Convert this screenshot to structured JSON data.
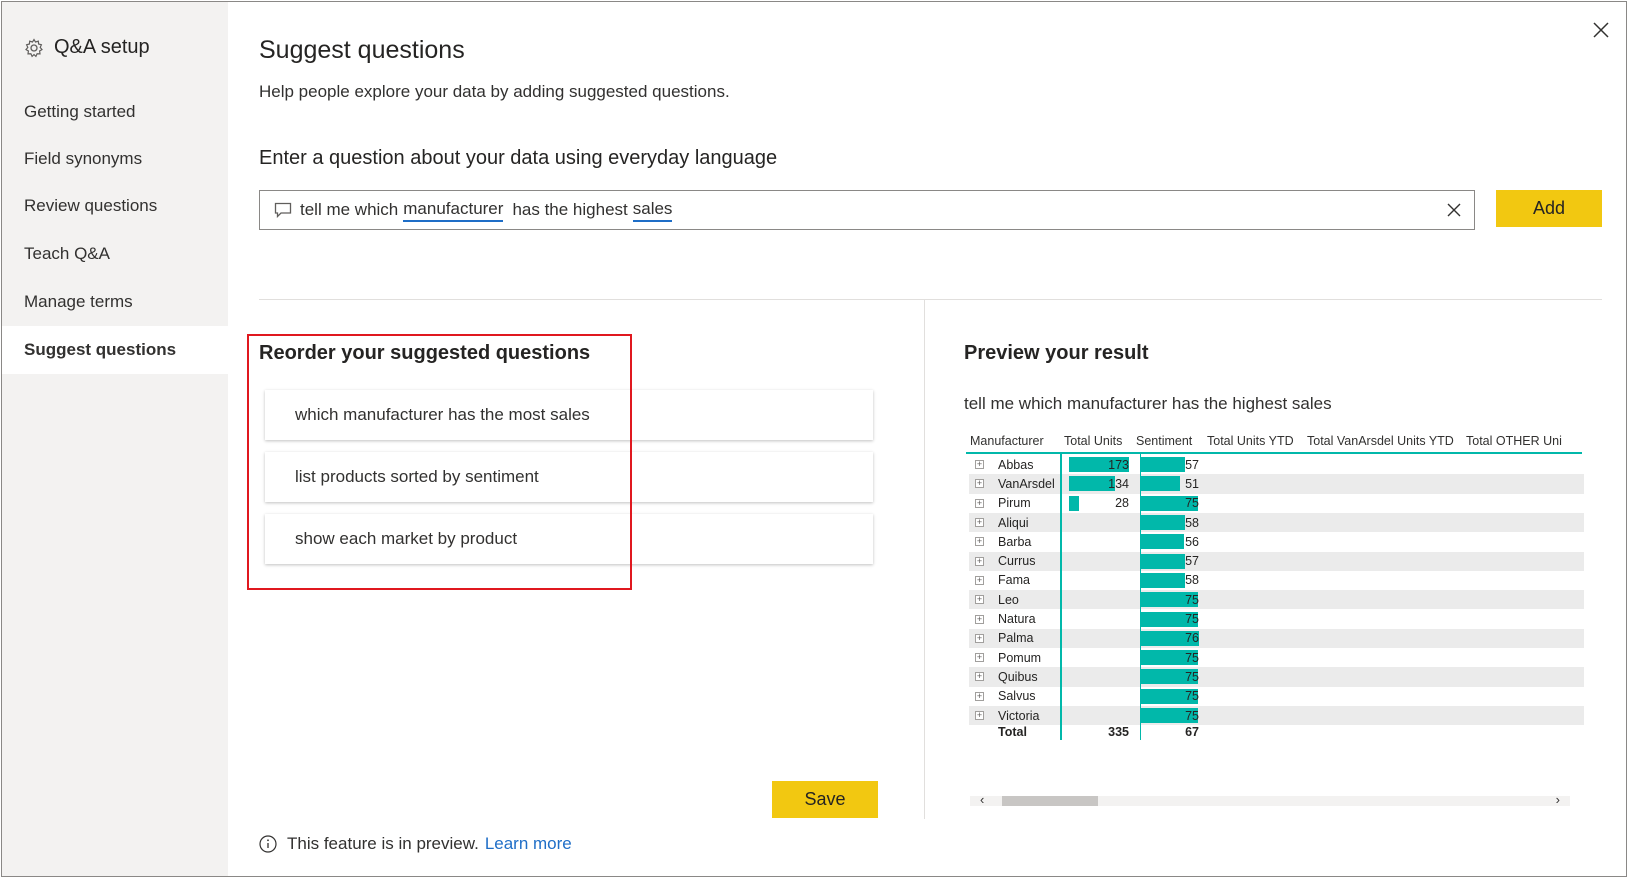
{
  "sidebar": {
    "title": "Q&A setup",
    "items": [
      {
        "label": "Getting started"
      },
      {
        "label": "Field synonyms"
      },
      {
        "label": "Review questions"
      },
      {
        "label": "Teach Q&A"
      },
      {
        "label": "Manage terms"
      },
      {
        "label": "Suggest questions"
      }
    ]
  },
  "main": {
    "title": "Suggest questions",
    "subtitle": "Help people explore your data by adding suggested questions.",
    "prompt_label": "Enter a question about your data using everyday language",
    "question": {
      "part1": "tell me which",
      "part2": "manufacturer",
      "part3": "has the highest",
      "part4": "sales"
    },
    "add_label": "Add",
    "reorder_title": "Reorder your suggested questions",
    "suggestions": [
      "which manufacturer has the most sales",
      "list products sorted by sentiment",
      "show each market by product"
    ],
    "save_label": "Save",
    "preview_note": "This feature is in preview.",
    "learn_more": "Learn more"
  },
  "preview": {
    "title": "Preview your result",
    "query": "tell me which manufacturer has the highest sales",
    "columns": [
      "Manufacturer",
      "Total Units",
      "Sentiment",
      "Total Units YTD",
      "Total VanArsdel Units YTD",
      "Total OTHER Uni"
    ],
    "rows": [
      {
        "name": "Abbas",
        "units": "173",
        "sentiment": "57"
      },
      {
        "name": "VanArsdel",
        "units": "134",
        "sentiment": "51"
      },
      {
        "name": "Pirum",
        "units": "28",
        "sentiment": "75"
      },
      {
        "name": "Aliqui",
        "units": "",
        "sentiment": "58"
      },
      {
        "name": "Barba",
        "units": "",
        "sentiment": "56"
      },
      {
        "name": "Currus",
        "units": "",
        "sentiment": "57"
      },
      {
        "name": "Fama",
        "units": "",
        "sentiment": "58"
      },
      {
        "name": "Leo",
        "units": "",
        "sentiment": "75"
      },
      {
        "name": "Natura",
        "units": "",
        "sentiment": "75"
      },
      {
        "name": "Palma",
        "units": "",
        "sentiment": "76"
      },
      {
        "name": "Pomum",
        "units": "",
        "sentiment": "75"
      },
      {
        "name": "Quibus",
        "units": "",
        "sentiment": "75"
      },
      {
        "name": "Salvus",
        "units": "",
        "sentiment": "75"
      },
      {
        "name": "Victoria",
        "units": "",
        "sentiment": "75"
      }
    ],
    "total": {
      "label": "Total",
      "units": "335",
      "sentiment": "67"
    }
  },
  "colors": {
    "accent_yellow": "#f2c811",
    "bar_teal": "#01b8aa",
    "highlight_red": "#e0181f",
    "link_blue": "#1f6ec7"
  },
  "icons": [
    "gear-icon",
    "close-icon",
    "chat-bubble-icon",
    "clear-icon",
    "info-icon",
    "expand-plus-icon",
    "scroll-left-icon",
    "scroll-right-icon"
  ]
}
